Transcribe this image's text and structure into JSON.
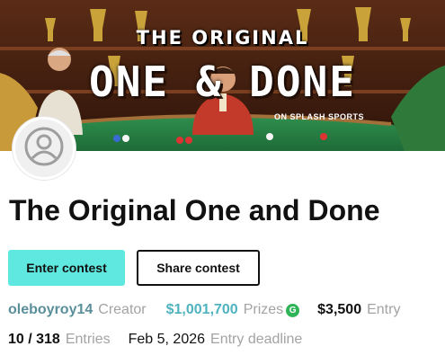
{
  "banner": {
    "title_top": "THE ORIGINAL",
    "title_main": "ONE & DONE",
    "subtitle": "ON SPLASH SPORTS",
    "colors": {
      "wood": "#4a2414",
      "felt": "#2f8f4e",
      "shirt_red": "#c43a2a"
    }
  },
  "avatar": {
    "icon": "user-placeholder-icon"
  },
  "contest": {
    "title": "The Original One and Done",
    "enter_label": "Enter contest",
    "share_label": "Share contest"
  },
  "stats": {
    "creator_name": "oleboyroy14",
    "creator_label": "Creator",
    "prizes_value": "$1,001,700",
    "prizes_label": "Prizes",
    "prizes_badge": "G",
    "entry_value": "$3,500",
    "entry_label": "Entry",
    "entries_value": "10 / 318",
    "entries_label": "Entries",
    "deadline_value": "Feb 5, 2026",
    "deadline_label": "Entry deadline"
  },
  "colors": {
    "accent": "#5fe8e0",
    "link": "#4fb3bf",
    "muted": "#a3a3a3",
    "badge": "#2fb457"
  }
}
